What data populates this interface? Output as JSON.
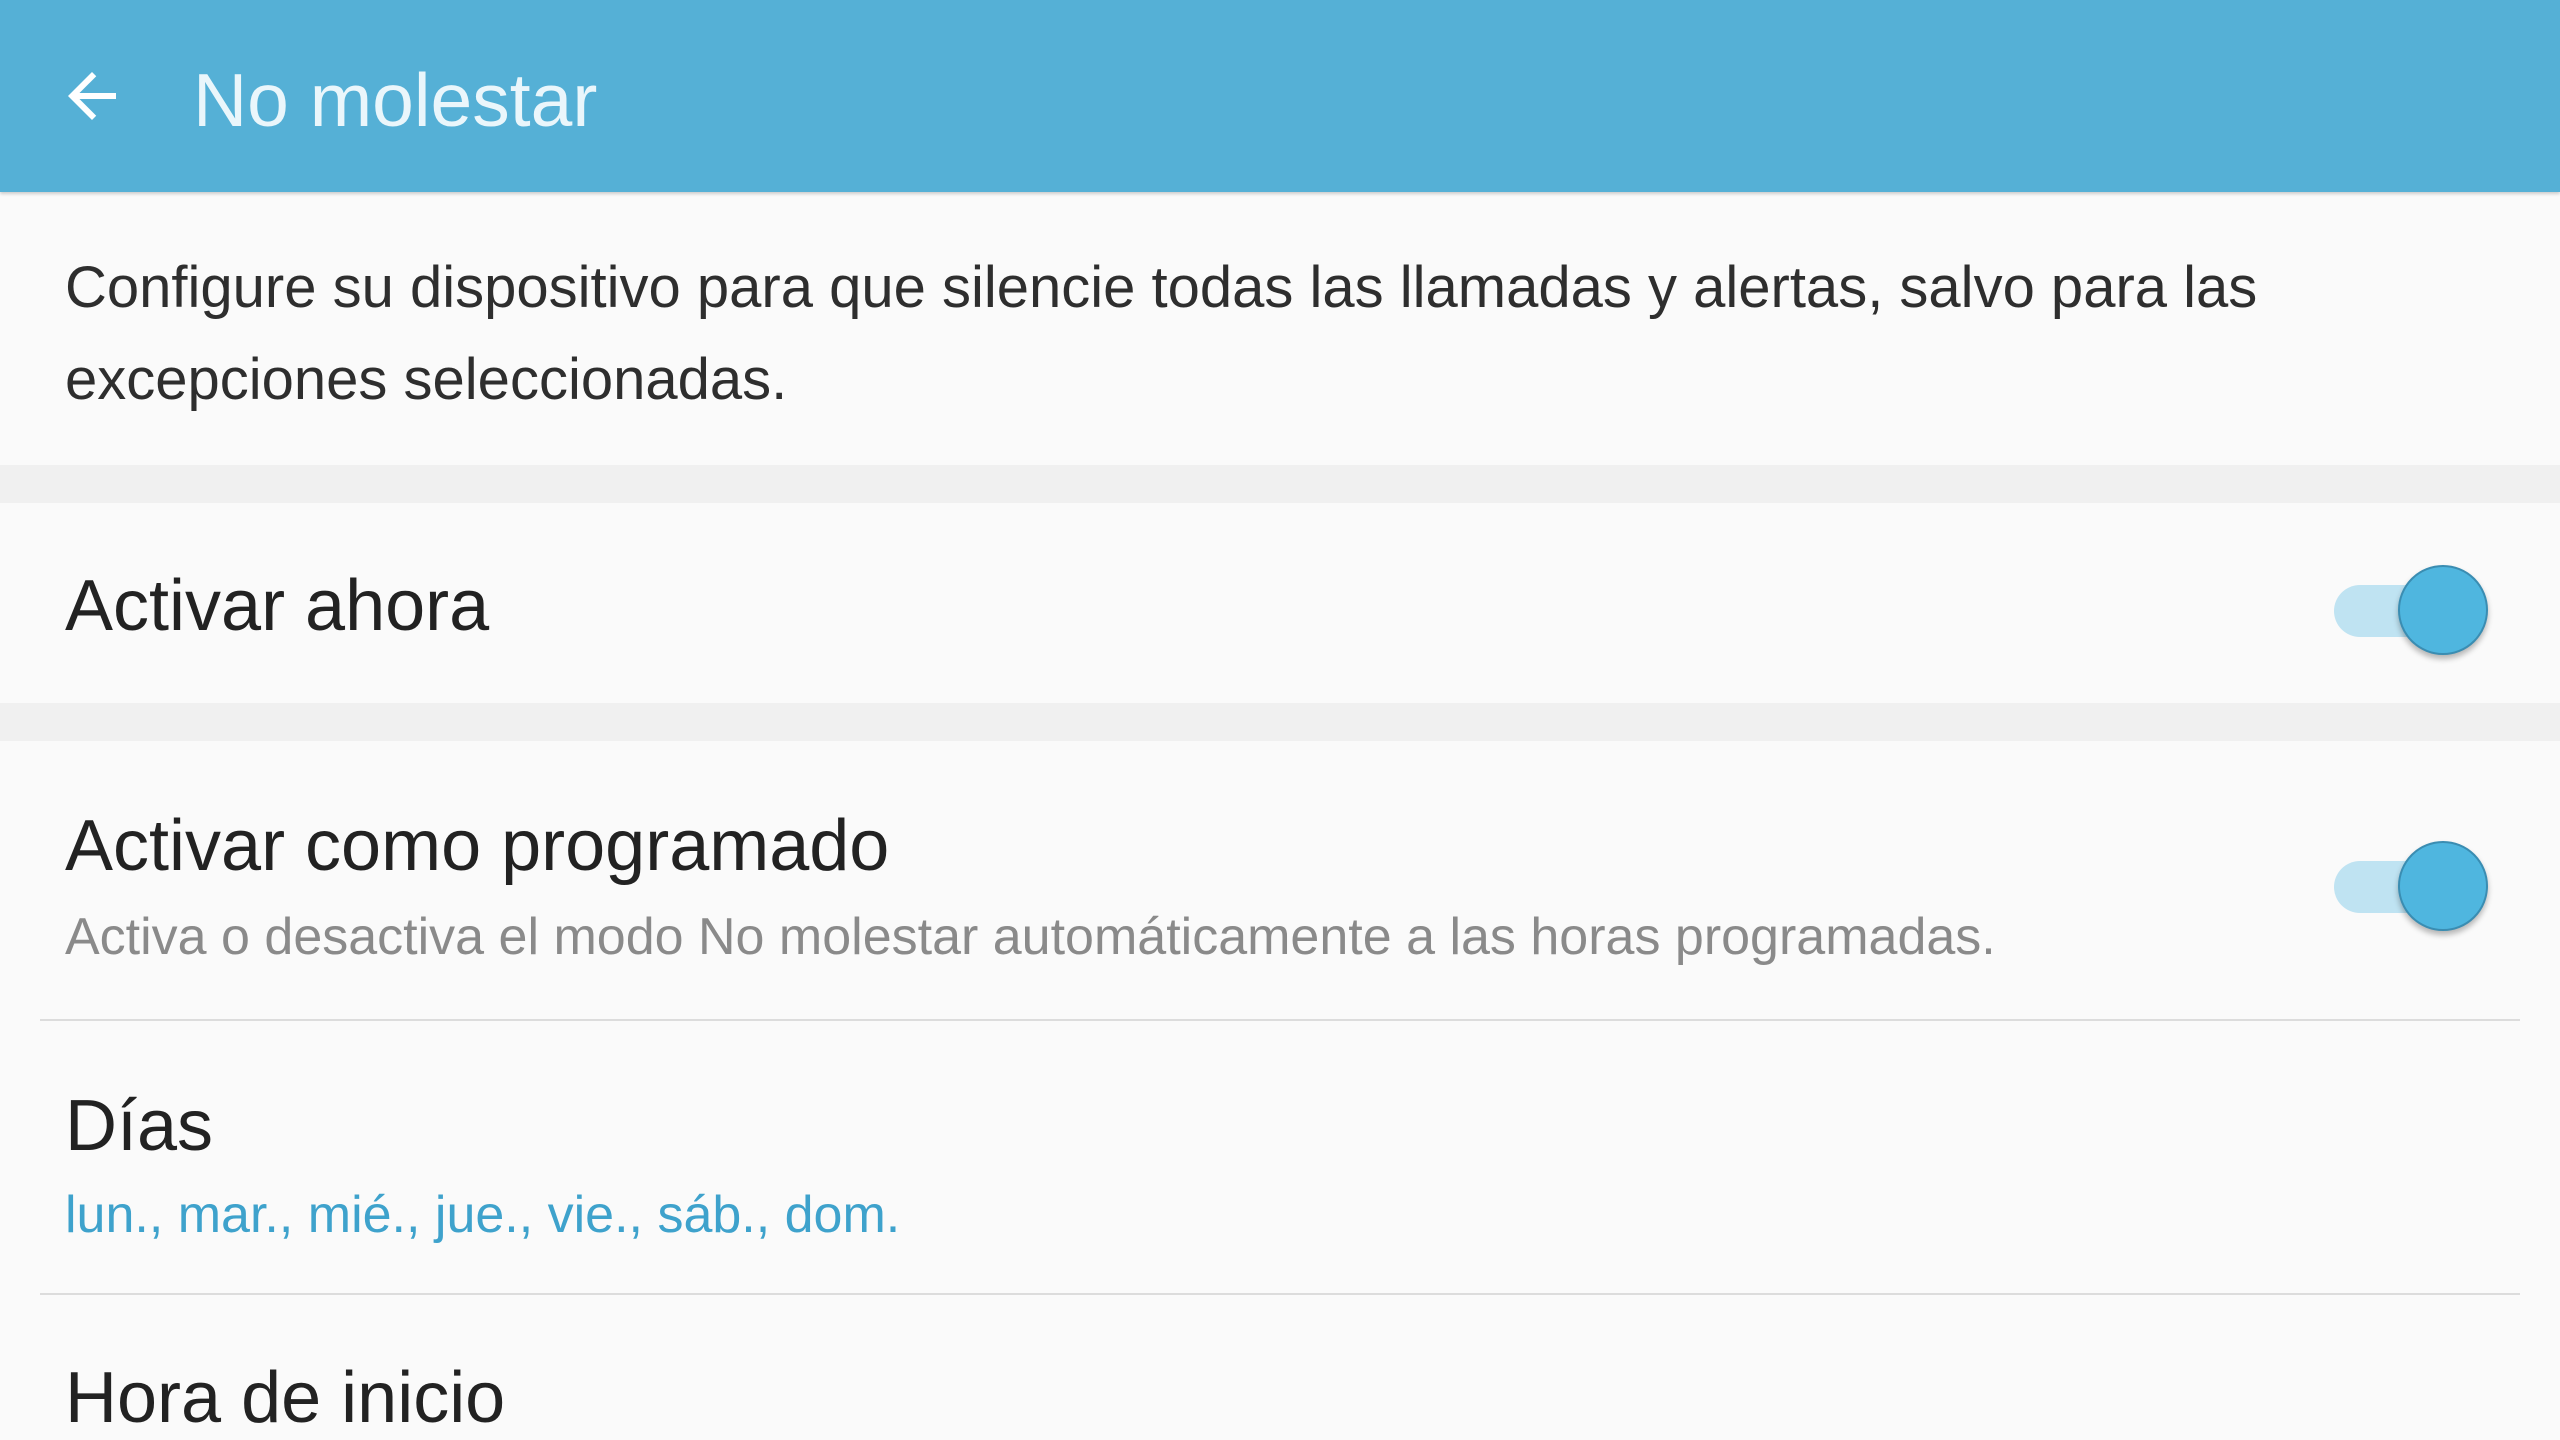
{
  "appbar": {
    "title": "No molestar",
    "color": "#55b0d6"
  },
  "description": "Configure su dispositivo para que silencie todas las llamadas y alertas, salvo para las excepciones seleccionadas.",
  "settings": {
    "activate_now": {
      "title": "Activar ahora",
      "enabled": true
    },
    "scheduled": {
      "title": "Activar como programado",
      "subtitle": "Activa o desactiva el modo No molestar automáticamente a las horas programadas.",
      "enabled": true
    },
    "days": {
      "title": "Días",
      "value": "lun., mar., mié., jue., vie., sáb., dom."
    },
    "start_time": {
      "title": "Hora de inicio"
    }
  },
  "icons": {
    "back": "arrow-left-icon"
  },
  "colors": {
    "accent": "#4fb6df",
    "accent_text": "#3ea2cc",
    "switch_track": "#bfe3f2"
  }
}
